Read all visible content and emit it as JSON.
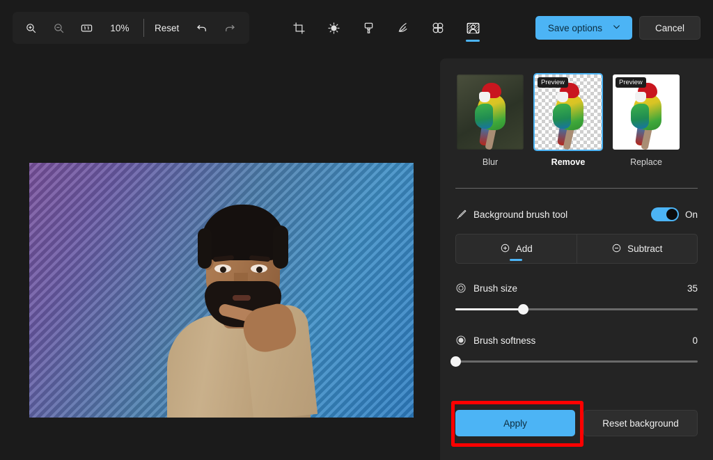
{
  "toolbar": {
    "zoom_in_icon": "zoom-in-icon",
    "zoom_out_icon": "zoom-out-icon",
    "actual_size_icon": "one-to-one-icon",
    "zoom_level": "10%",
    "reset_label": "Reset",
    "undo_icon": "undo-icon",
    "redo_icon": "redo-icon",
    "tools": [
      {
        "name": "crop-tool",
        "icon": "crop-icon",
        "active": false
      },
      {
        "name": "adjustments-tool",
        "icon": "brightness-icon",
        "active": false
      },
      {
        "name": "markup-tool",
        "icon": "paintbrush-icon",
        "active": false
      },
      {
        "name": "draw-tool",
        "icon": "pen-icon",
        "active": false
      },
      {
        "name": "erase-tool",
        "icon": "erase-blur-icon",
        "active": false
      },
      {
        "name": "background-tool",
        "icon": "background-remove-icon",
        "active": true
      }
    ],
    "save_options_label": "Save options",
    "save_options_chevron": "chevron-down-icon",
    "cancel_label": "Cancel"
  },
  "panel": {
    "modes": [
      {
        "label": "Blur",
        "selected": false,
        "badge": ""
      },
      {
        "label": "Remove",
        "selected": true,
        "badge": "Preview"
      },
      {
        "label": "Replace",
        "selected": false,
        "badge": "Preview"
      }
    ],
    "brush_tool": {
      "icon": "paintbrush-icon",
      "label": "Background brush tool",
      "toggle_state": "On"
    },
    "segmented": [
      {
        "label": "Add",
        "icon": "plus-circle-icon",
        "active": true
      },
      {
        "label": "Subtract",
        "icon": "minus-circle-icon",
        "active": false
      }
    ],
    "brush_size": {
      "icon": "target-circle-icon",
      "label": "Brush size",
      "value": "35",
      "percent": 28
    },
    "brush_softness": {
      "icon": "filled-circle-icon",
      "label": "Brush softness",
      "value": "0",
      "percent": 0
    },
    "apply_label": "Apply",
    "reset_background_label": "Reset background"
  },
  "colors": {
    "accent": "#4cb4f5",
    "panel_bg": "#242424",
    "app_bg": "#1b1b1b",
    "highlight": "#ff0000"
  }
}
